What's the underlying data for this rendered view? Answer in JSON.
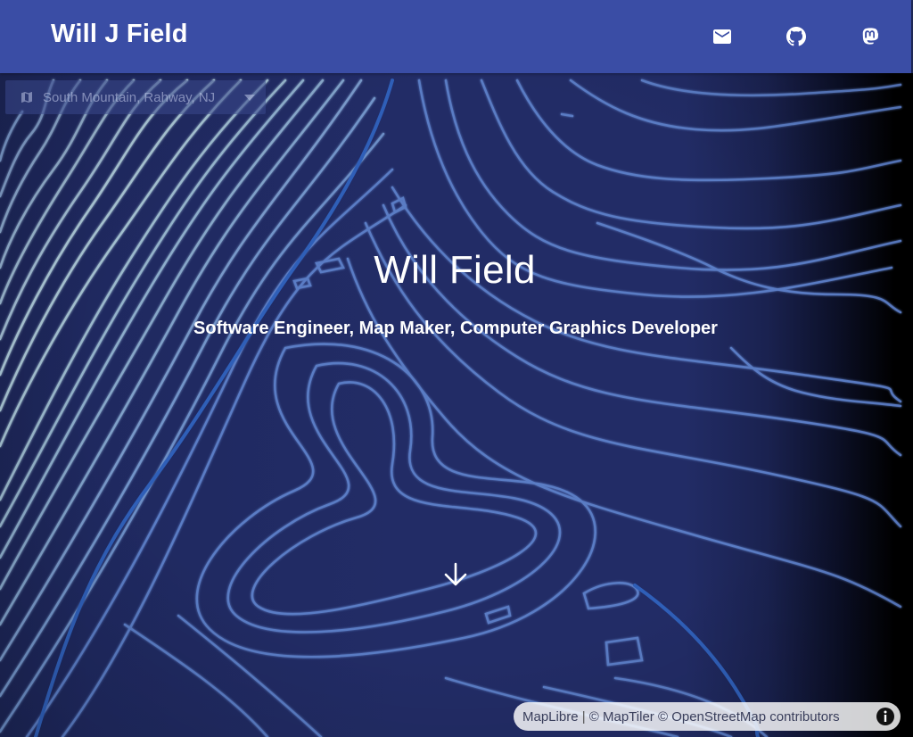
{
  "header": {
    "brand": "Will J Field",
    "links": [
      {
        "name": "email",
        "icon": "mail-icon"
      },
      {
        "name": "github",
        "icon": "github-icon"
      },
      {
        "name": "mastodon",
        "icon": "mastodon-icon"
      }
    ]
  },
  "location_select": {
    "icon": "map-icon",
    "value": "South Mountain, Rahway, NJ",
    "caret": "caret-down-icon"
  },
  "hero": {
    "title": "Will Field",
    "subtitle": "Software Engineer, Map Maker, Computer Graphics Developer",
    "scroll_icon": "arrow-down-icon"
  },
  "attribution": {
    "maplibre": "MapLibre",
    "separator": " | ",
    "maptiler": "© MapTiler",
    "osm": "© OpenStreetMap contributors",
    "info_icon": "info-icon"
  },
  "colors": {
    "header_bg": "#3a4da5",
    "map_bg": "#222c66",
    "contour": "#5a7cc4",
    "stream": "#2f5fb8",
    "text": "#ffffff"
  }
}
